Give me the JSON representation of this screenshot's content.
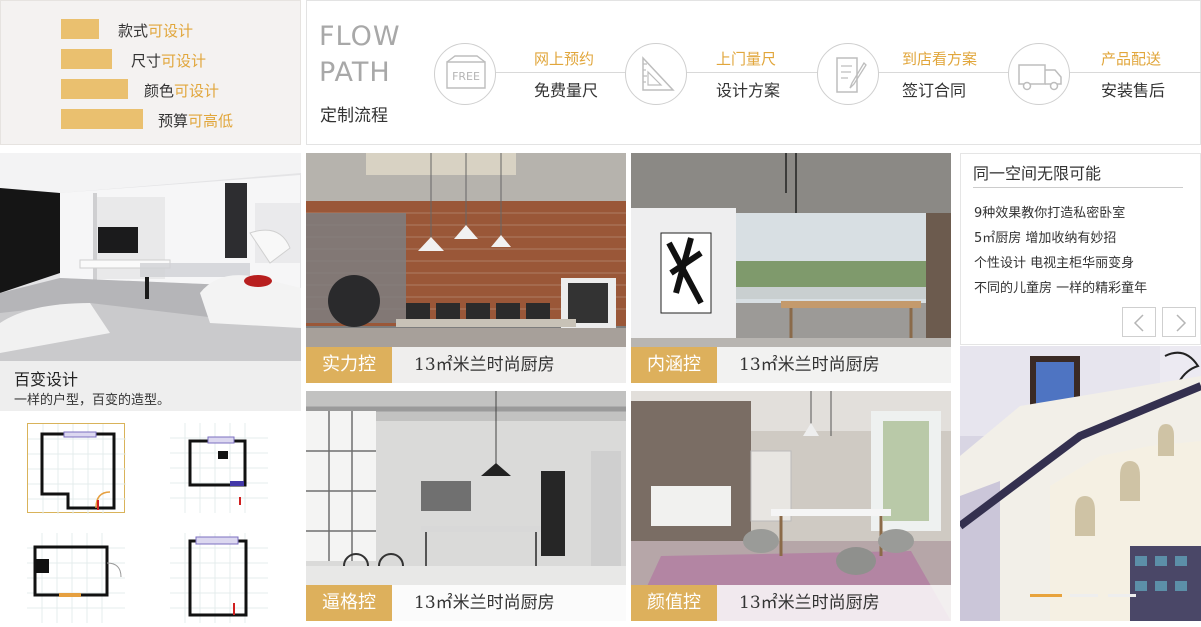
{
  "features": [
    {
      "prefix": "款式",
      "highlight": "可设计"
    },
    {
      "prefix": "尺寸",
      "highlight": "可设计"
    },
    {
      "prefix": "颜色",
      "highlight": "可设计"
    },
    {
      "prefix": "预算",
      "highlight": "可高低"
    }
  ],
  "flow": {
    "title_line1": "FLOW",
    "title_line2": "PATH",
    "subtitle": "定制流程",
    "free_badge": "FREE",
    "steps": [
      {
        "top": "网上预约",
        "bottom": "免费量尺",
        "icon": "free-badge-icon"
      },
      {
        "top": "上门量尺",
        "bottom": "设计方案",
        "icon": "ruler-triangle-icon"
      },
      {
        "top": "到店看方案",
        "bottom": "签订合同",
        "icon": "contract-pen-icon"
      },
      {
        "top": "产品配送",
        "bottom": "安装售后",
        "icon": "delivery-truck-icon"
      }
    ]
  },
  "variety": {
    "title": "百变设计",
    "desc": "一样的户型，百变的造型。"
  },
  "tiles": [
    {
      "tag": "实力控",
      "text": "13㎡米兰时尚厨房"
    },
    {
      "tag": "内涵控",
      "text": "13㎡米兰时尚厨房"
    },
    {
      "tag": "逼格控",
      "text": "13㎡米兰时尚厨房"
    },
    {
      "tag": "颜值控",
      "text": "13㎡米兰时尚厨房"
    }
  ],
  "space": {
    "title": "同一空间无限可能",
    "links": [
      "9种效果教你打造私密卧室",
      "5㎡厨房 增加收纳有妙招",
      "个性设计 电视主柜华丽变身",
      "不同的儿童房 一样的精彩童年"
    ]
  },
  "colors": {
    "accent": "#eac06f",
    "accent_text": "#e1a63b",
    "tag_bg": "#ddb05c"
  },
  "carousel": {
    "total": 3,
    "active": 1
  }
}
